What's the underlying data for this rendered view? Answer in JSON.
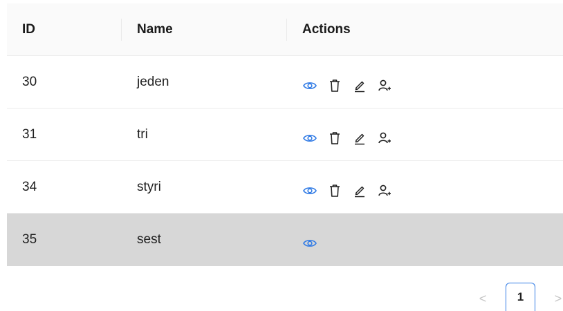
{
  "table": {
    "columns": [
      "ID",
      "Name",
      "Actions"
    ],
    "rows": [
      {
        "id": "30",
        "name": "jeden",
        "actions": [
          "eye-icon",
          "trash-icon",
          "edit-icon",
          "user-add-icon"
        ]
      },
      {
        "id": "31",
        "name": "tri",
        "actions": [
          "eye-icon",
          "trash-icon",
          "edit-icon",
          "user-add-icon"
        ]
      },
      {
        "id": "34",
        "name": "styri",
        "actions": [
          "eye-icon",
          "trash-icon",
          "edit-icon",
          "user-add-icon"
        ]
      },
      {
        "id": "35",
        "name": "sest",
        "actions": [
          "eye-icon"
        ]
      }
    ],
    "selected_row_id": "35"
  },
  "pagination": {
    "prev": "<",
    "current": "1",
    "next": ">"
  },
  "colors": {
    "eye_icon": "#2f7ae5",
    "action_icon": "#1f1f1f",
    "selected_row_bg": "#d7d7d7",
    "header_bg": "#fafafa",
    "active_page_border": "#2f7ae5"
  }
}
